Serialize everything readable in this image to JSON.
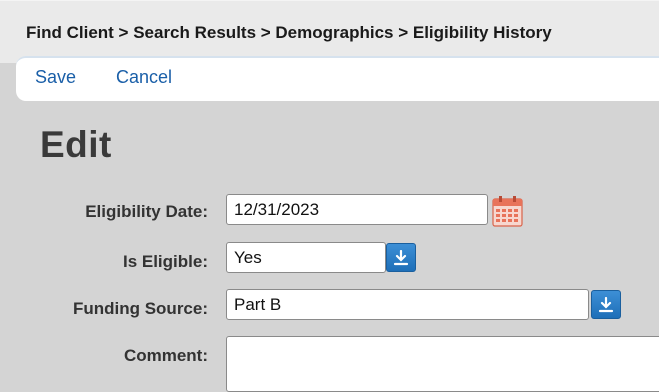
{
  "breadcrumb": "Find Client > Search Results > Demographics > Eligibility History",
  "toolbar": {
    "save_label": "Save",
    "cancel_label": "Cancel"
  },
  "page": {
    "title": "Edit"
  },
  "form": {
    "eligibility_date": {
      "label": "Eligibility Date:",
      "value": "12/31/2023"
    },
    "is_eligible": {
      "label": "Is Eligible:",
      "value": "Yes"
    },
    "funding_source": {
      "label": "Funding Source:",
      "value": "Part B"
    },
    "comment": {
      "label": "Comment:",
      "value": ""
    }
  },
  "colors": {
    "link": "#1a5fa8",
    "dropdown_button": "#2a7cc7",
    "calendar_icon": "#e8735a"
  }
}
